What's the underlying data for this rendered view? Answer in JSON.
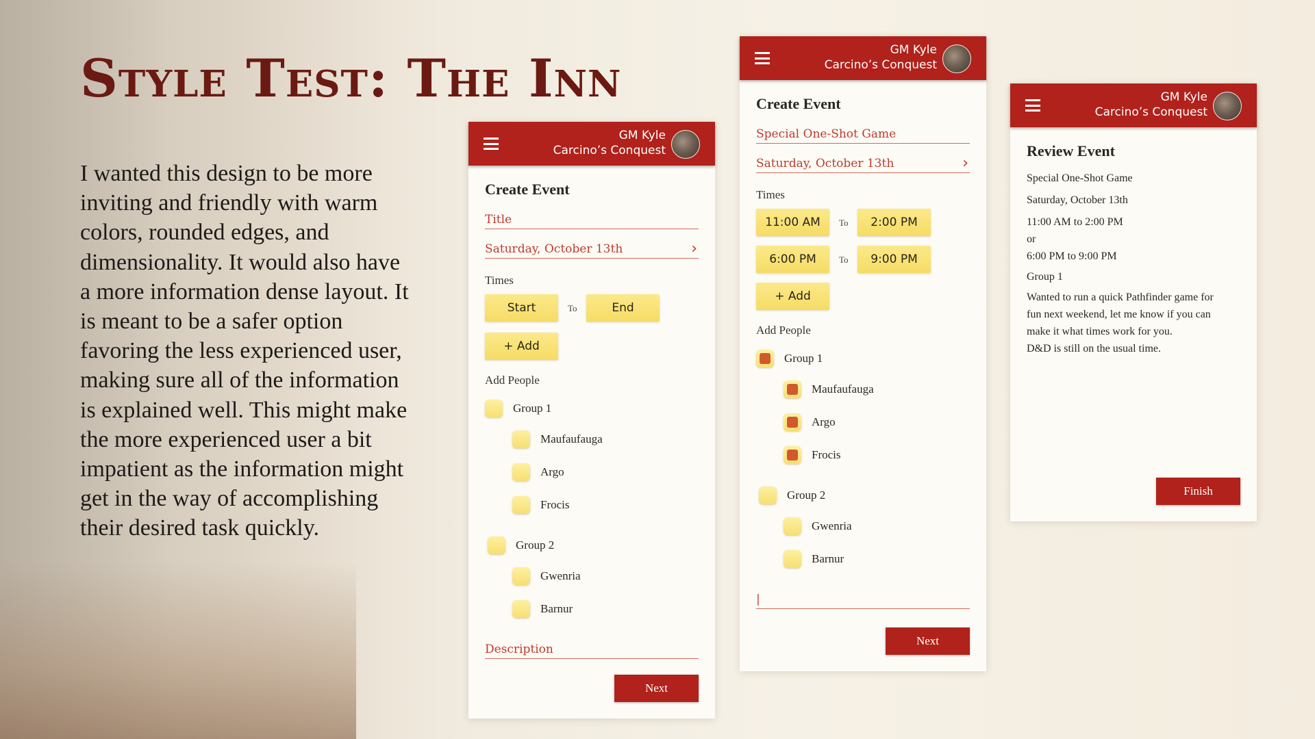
{
  "slide": {
    "title": "Style Test: The Inn",
    "body": "I wanted this design to be more inviting and friendly with warm colors, rounded edges, and dimensionality. It would also have a more information dense layout. It is meant to be a safer option favoring the less experienced user, making sure all of the information is explained well. This might make the more experienced user a bit impatient as the information might get in the way of accomplishing their desired task quickly."
  },
  "colors": {
    "appbar": "#b0221b",
    "accent": "#c0392b",
    "button_yellow": "#f6dc66",
    "checkbox_fill": "#cf5a2c"
  },
  "appbar": {
    "user": "GM Kyle",
    "campaign": "Carcino’s Conquest",
    "menu_icon": "hamburger-icon",
    "avatar_icon": "avatar"
  },
  "screen1": {
    "title": "Create Event",
    "title_field": "Title",
    "date_field": "Saturday, October 13th",
    "times_label": "Times",
    "start": "Start",
    "to": "To",
    "end": "End",
    "add": "+ Add",
    "add_people": "Add People",
    "group1": "Group 1",
    "members1": [
      "Maufaufauga",
      "Argo",
      "Frocis"
    ],
    "group2": "Group 2",
    "members2": [
      "Gwenria",
      "Barnur"
    ],
    "description_field": "Description",
    "next": "Next"
  },
  "screen2": {
    "title": "Create Event",
    "title_field": "Special One-Shot Game",
    "date_field": "Saturday, October 13th",
    "times_label": "Times",
    "times": [
      {
        "start": "11:00 AM",
        "end": "2:00 PM"
      },
      {
        "start": "6:00 PM",
        "end": "9:00 PM"
      }
    ],
    "to": "To",
    "add": "+ Add",
    "add_people": "Add People",
    "group1": "Group 1",
    "group1_checked": true,
    "members1": [
      "Maufaufauga",
      "Argo",
      "Frocis"
    ],
    "members1_checked": [
      true,
      true,
      true
    ],
    "group2": "Group 2",
    "members2": [
      "Gwenria",
      "Barnur"
    ],
    "description_field": "|",
    "next": "Next"
  },
  "screen3": {
    "title": "Review Event",
    "event_title": "Special One-Shot Game",
    "date": "Saturday, October 13th",
    "time1": "11:00 AM to 2:00 PM",
    "or": "or",
    "time2": "6:00 PM to 9:00 PM",
    "group": "Group 1",
    "description_lines": [
      "Wanted to run a quick Pathfinder game for",
      "fun next weekend, let me know if you can",
      "make it what times work for you.",
      "D&D is still on the usual time."
    ],
    "finish": "Finish"
  }
}
